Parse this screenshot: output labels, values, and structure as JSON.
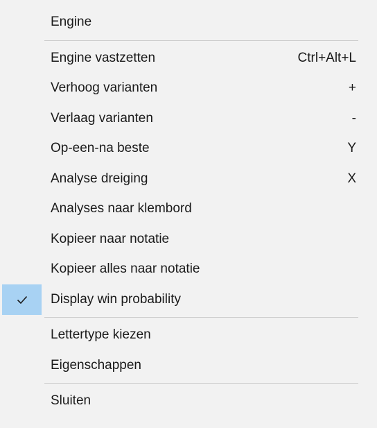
{
  "menu": {
    "header": {
      "label": "Engine"
    },
    "items_group1": [
      {
        "label": "Engine vastzetten",
        "shortcut": "Ctrl+Alt+L"
      },
      {
        "label": "Verhoog varianten",
        "shortcut": "+"
      },
      {
        "label": "Verlaag varianten",
        "shortcut": "-"
      },
      {
        "label": "Op-een-na beste",
        "shortcut": "Y"
      },
      {
        "label": "Analyse dreiging",
        "shortcut": "X"
      },
      {
        "label": "Analyses naar klembord",
        "shortcut": ""
      },
      {
        "label": "Kopieer naar notatie",
        "shortcut": ""
      },
      {
        "label": "Kopieer alles naar notatie",
        "shortcut": ""
      },
      {
        "label": "Display win probability",
        "shortcut": "",
        "checked": true
      }
    ],
    "items_group2": [
      {
        "label": "Lettertype kiezen"
      },
      {
        "label": "Eigenschappen"
      }
    ],
    "items_group3": [
      {
        "label": "Sluiten"
      }
    ]
  },
  "colors": {
    "background": "#f2f2f2",
    "check_highlight": "#a8d2f3",
    "separator": "#cdcdcd",
    "text": "#1a1a1a"
  },
  "icons": {
    "check": "checkmark-icon"
  }
}
